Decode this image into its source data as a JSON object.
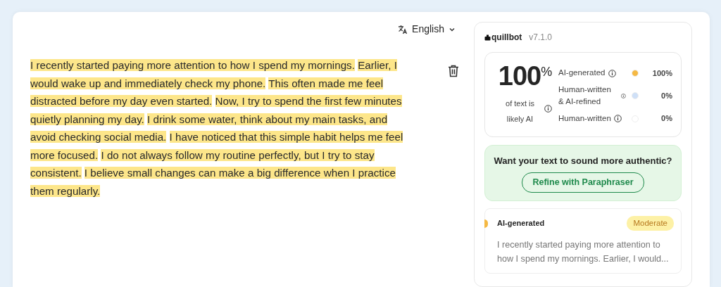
{
  "language_selector": {
    "label": "English"
  },
  "editor": {
    "sentences": [
      {
        "text": "I recently started paying more attention to how I spend my mornings.",
        "highlighted": true
      },
      {
        "text": "Earlier, I would wake up and immediately check my phone.",
        "highlighted": true
      },
      {
        "text": "This often made me feel distracted before my day even started.",
        "highlighted": true
      },
      {
        "text": "Now, I try to spend the first few minutes quietly planning my day.",
        "highlighted": true
      },
      {
        "text": "I drink some water, think about my main tasks, and avoid checking social media.",
        "highlighted": true
      },
      {
        "text": "I have noticed that this simple habit helps me feel more focused.",
        "highlighted": true
      },
      {
        "text": "I do not always follow my routine perfectly, but I try to stay consistent.",
        "highlighted": true
      },
      {
        "text": "I believe small changes can make a big difference when I practice them regularly.",
        "highlighted": true
      }
    ]
  },
  "panel": {
    "brand": "quillbot",
    "version": "v7.1.0",
    "score": {
      "value": "100",
      "unit": "%",
      "caption": "of text is likely AI"
    },
    "categories": [
      {
        "label": "AI-generated",
        "percent": "100%",
        "color": "#f5b944"
      },
      {
        "label": "Human-written & AI-refined",
        "percent": "0%",
        "color": "#cfe0f7"
      },
      {
        "label": "Human-written",
        "percent": "0%",
        "color": "#ffffff"
      }
    ],
    "promo": {
      "text": "Want your text to sound more authentic?",
      "button": "Refine with Paraphraser"
    },
    "result": {
      "label": "AI-generated",
      "color": "#f5b944",
      "badge": "Moderate",
      "excerpt": "I recently started paying more attention to how I spend my mornings. Earlier, I would..."
    }
  }
}
